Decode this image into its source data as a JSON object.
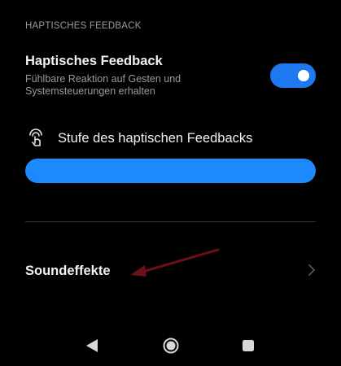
{
  "section": {
    "header": "HAPTISCHES FEEDBACK"
  },
  "haptic": {
    "title": "Haptisches Feedback",
    "summary": "Fühlbare Reaktion auf Gesten und Systemsteuerungen erhalten",
    "enabled": true
  },
  "level": {
    "label": "Stufe des haptischen Feedbacks",
    "value_fraction": 1.0
  },
  "sound": {
    "label": "Soundeffekte"
  },
  "colors": {
    "accent": "#1e88ff",
    "toggle": "#1e78f0",
    "annotation_arrow": "#6b0f1a",
    "background": "#000000"
  },
  "icons": {
    "level": "finger-touch-icon",
    "chevron": "chevron-right-icon",
    "back": "back-triangle-icon",
    "home": "home-circle-icon",
    "recent": "recent-square-icon"
  }
}
